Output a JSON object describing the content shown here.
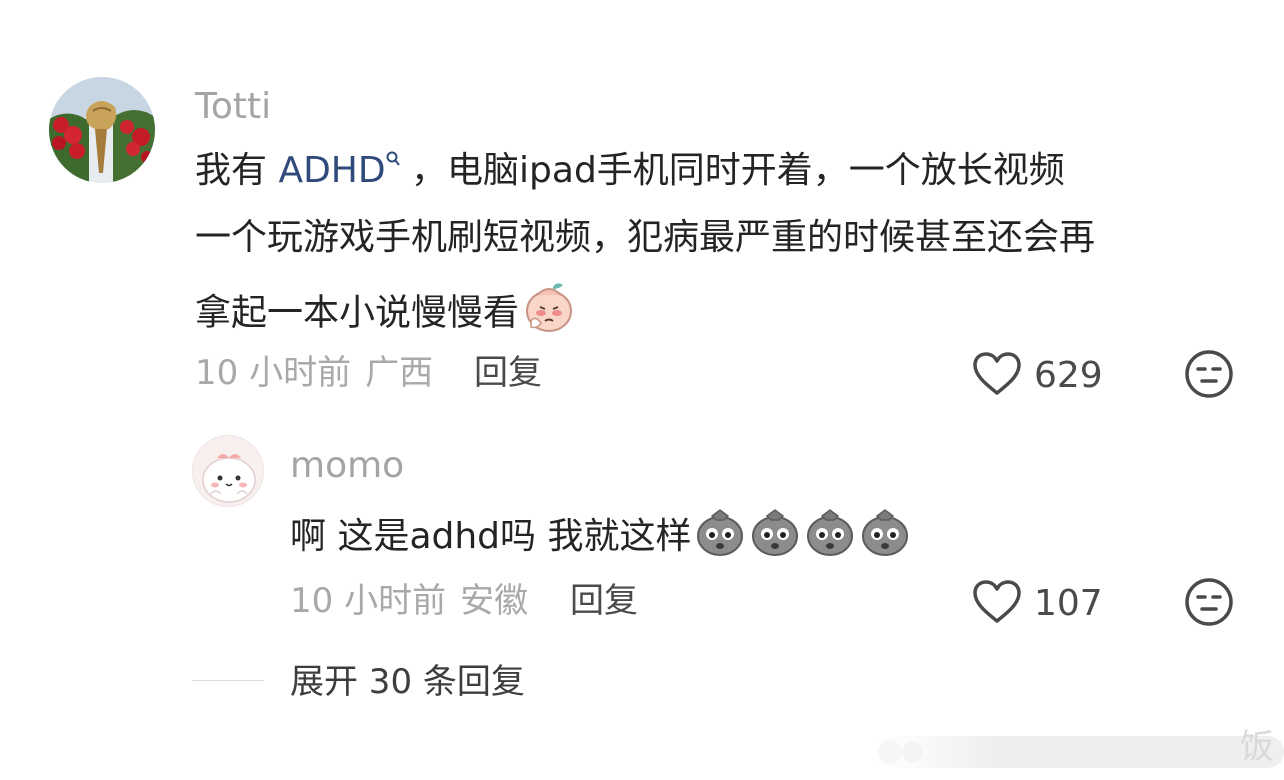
{
  "comment": {
    "username": "Totti",
    "text_line1_before": "我有 ",
    "mention": "ADHD",
    "mention_icon": "search-mini-icon",
    "text_line1_after": " ，电脑ipad手机同时开着，一个放长视频",
    "text_line2": "一个玩游戏手机刷短视频，犯病最严重的时候甚至还会再",
    "text_line3": "拿起一本小说慢慢看",
    "emoji": "flushed-sticker-icon",
    "time": "10 小时前",
    "location": "广西",
    "reply_label": "回复",
    "likes": "629"
  },
  "reply": {
    "username": "momo",
    "text": "啊 这是adhd吗 我就这样",
    "emoji": "grey-stone-sticker-icon",
    "emoji_count": 4,
    "time": "10 小时前",
    "location": "安徽",
    "reply_label": "回复",
    "likes": "107"
  },
  "expand_label": "展开 30 条回复",
  "watermark": "饭",
  "colors": {
    "link": "#2f4a7b",
    "meta": "#a9a9a9",
    "text": "#242424"
  }
}
